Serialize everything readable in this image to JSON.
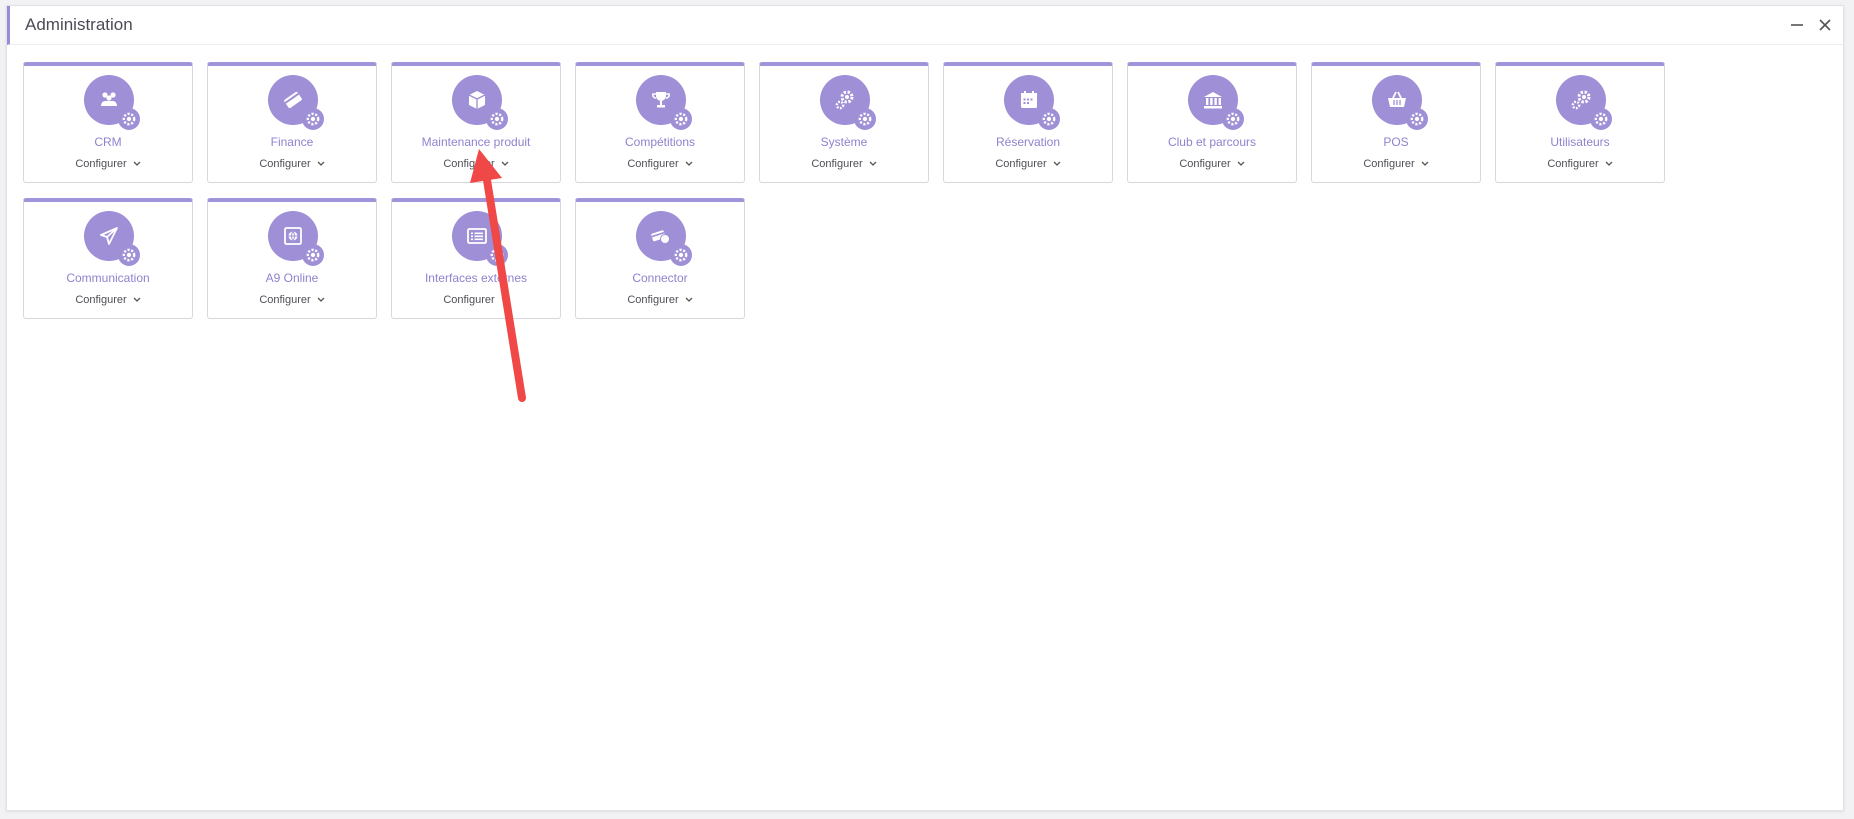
{
  "window": {
    "title": "Administration",
    "accent_color": "#9e8fd6",
    "minimize_icon": "minimize-icon",
    "close_icon": "close-icon"
  },
  "tiles": [
    {
      "label": "CRM",
      "configure": "Configurer",
      "icon": "people-group-icon"
    },
    {
      "label": "Finance",
      "configure": "Configurer",
      "icon": "credit-card-icon"
    },
    {
      "label": "Maintenance produit",
      "configure": "Configurer",
      "icon": "box-icon"
    },
    {
      "label": "Compétitions",
      "configure": "Configurer",
      "icon": "trophy-icon"
    },
    {
      "label": "Système",
      "configure": "Configurer",
      "icon": "gears-icon"
    },
    {
      "label": "Réservation",
      "configure": "Configurer",
      "icon": "calendar-icon"
    },
    {
      "label": "Club et parcours",
      "configure": "Configurer",
      "icon": "building-columns-icon"
    },
    {
      "label": "POS",
      "configure": "Configurer",
      "icon": "shopping-basket-icon"
    },
    {
      "label": "Utilisateurs",
      "configure": "Configurer",
      "icon": "user-gears-icon"
    },
    {
      "label": "Communication",
      "configure": "Configurer",
      "icon": "paper-plane-icon"
    },
    {
      "label": "A9 Online",
      "configure": "Configurer",
      "icon": "globe-window-icon"
    },
    {
      "label": "Interfaces externes",
      "configure": "Configurer",
      "icon": "list-window-icon"
    },
    {
      "label": "Connector",
      "configure": "Configurer",
      "icon": "connector-icon"
    }
  ],
  "annotation": {
    "type": "red-arrow",
    "color": "#f04747",
    "points_to": "Maintenance produit"
  }
}
